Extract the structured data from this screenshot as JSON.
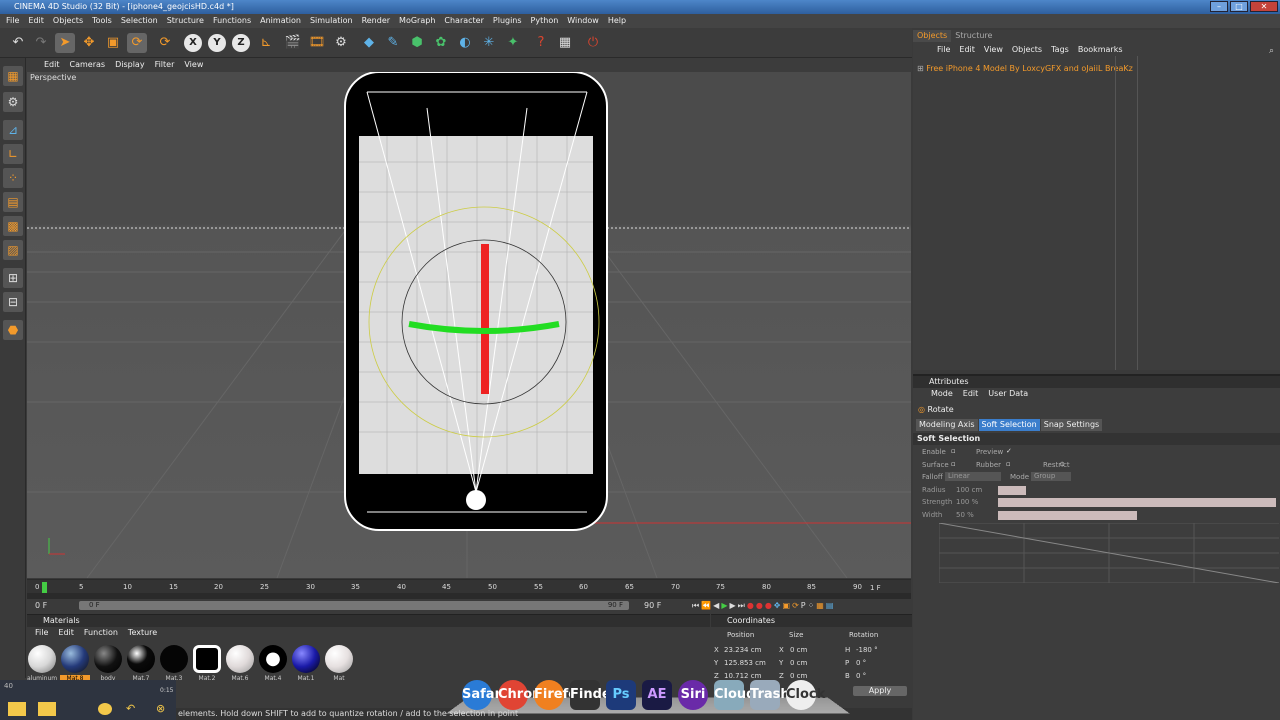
{
  "window": {
    "title": "CINEMA 4D Studio (32 Bit) - [iphone4_geojcisHD.c4d *]",
    "minimize": "–",
    "maximize": "□",
    "close": "✕"
  },
  "menu": [
    "File",
    "Edit",
    "Objects",
    "Tools",
    "Selection",
    "Structure",
    "Functions",
    "Animation",
    "Simulation",
    "Render",
    "MoGraph",
    "Character",
    "Plugins",
    "Python",
    "Window",
    "Help"
  ],
  "toolbar_icons": [
    "undo-icon",
    "redo-icon",
    "live-selection-icon",
    "move-icon",
    "scale-icon",
    "rotate-icon",
    "recent-tool-icon",
    "x-axis-icon",
    "y-axis-icon",
    "z-axis-icon",
    "coordinate-system-icon",
    "render-view-icon",
    "render-picture-viewer-icon",
    "edit-render-settings-icon",
    "cube-icon",
    "spline-pen-icon",
    "nurbs-icon",
    "array-icon",
    "deformer-icon",
    "scene-icon",
    "light-icon",
    "camera-icon",
    "help-icon",
    "layout-icon",
    "python-icon"
  ],
  "toolbar_axes": [
    "X",
    "Y",
    "Z"
  ],
  "viewport": {
    "menu": [
      "Edit",
      "Cameras",
      "Display",
      "Filter",
      "View"
    ],
    "label": "Perspective"
  },
  "timeline": {
    "ticks": [
      "0",
      "5",
      "10",
      "15",
      "20",
      "25",
      "30",
      "35",
      "40",
      "45",
      "50",
      "55",
      "60",
      "65",
      "70",
      "75",
      "80",
      "85",
      "90"
    ],
    "current_frame": "1 F",
    "start": "0 F",
    "range_start": "0 F",
    "range_end": "90 F",
    "end": "90 F"
  },
  "materials": {
    "title": "Materials",
    "menu": [
      "File",
      "Edit",
      "Function",
      "Texture"
    ],
    "items": [
      {
        "label": "aluminum",
        "color": "#d8d8d8"
      },
      {
        "label": "Mat.8",
        "color": "#243a7a"
      },
      {
        "label": "body",
        "color": "#111111"
      },
      {
        "label": "Mat.7",
        "color": "#0a0a0a"
      },
      {
        "label": "Mat.3",
        "color": "#050505"
      },
      {
        "label": "Mat.2",
        "color": "#000000"
      },
      {
        "label": "Mat.6",
        "color": "#e0dada"
      },
      {
        "label": "Mat.4",
        "color": "#f2f2f2"
      },
      {
        "label": "Mat.1",
        "color": "#1a1aa8"
      },
      {
        "label": "Mat",
        "color": "#e6e0e0"
      }
    ]
  },
  "coordinates": {
    "title": "Coordinates",
    "headers": [
      "Position",
      "Size",
      "Rotation"
    ],
    "rows": [
      {
        "axis": "X",
        "pos": "23.234 cm",
        "size_axis": "X",
        "size": "0 cm",
        "rot_axis": "H",
        "rot": "-180 °"
      },
      {
        "axis": "Y",
        "pos": "125.853 cm",
        "size_axis": "Y",
        "size": "0 cm",
        "rot_axis": "P",
        "rot": "0 °"
      },
      {
        "axis": "Z",
        "pos": "10.712 cm",
        "size_axis": "Z",
        "size": "0 cm",
        "rot_axis": "B",
        "rot": "0 °"
      }
    ],
    "apply": "Apply"
  },
  "objects": {
    "tabs": [
      "Objects",
      "Structure"
    ],
    "menu": [
      "File",
      "Edit",
      "View",
      "Objects",
      "Tags",
      "Bookmarks"
    ],
    "item": "Free iPhone 4 Model By LoxcyGFX and oJaiiL BreaKz"
  },
  "attributes": {
    "title": "Attributes",
    "menu": [
      "Mode",
      "Edit",
      "User Data"
    ],
    "tool": "Rotate",
    "tabs": [
      "Modeling Axis",
      "Soft Selection",
      "Snap Settings"
    ],
    "section": "Soft Selection",
    "enable": "Enable",
    "preview": "Preview",
    "surface": "Surface",
    "rubber": "Rubber",
    "restrict": "Restrict",
    "falloff": "Falloff",
    "falloff_val": "Linear",
    "mode": "Mode",
    "mode_val": "Group",
    "radius": "Radius",
    "radius_val": "100 cm",
    "strength": "Strength",
    "strength_val": "100 %",
    "width": "Width",
    "width_val": "50 %"
  },
  "status": "elements. Hold down SHIFT to add to quantize rotation / add to the selection in point",
  "taskbar": {
    "time": "0:15"
  },
  "dock": [
    "Safari",
    "Chrome",
    "Firefox",
    "Finder",
    "Ps",
    "AE",
    "Siri",
    "Cloud",
    "Trash",
    "Clock"
  ]
}
